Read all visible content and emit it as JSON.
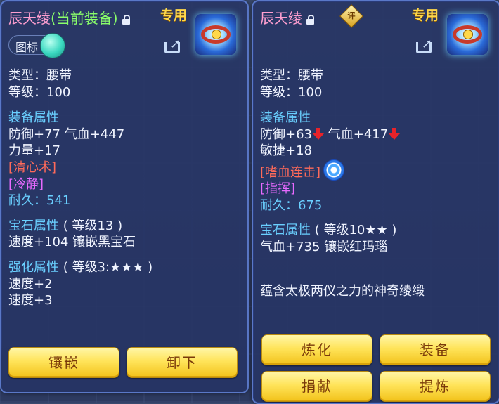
{
  "left": {
    "name": "辰天绫",
    "equipped_tag": "(当前装备)",
    "special": "专用",
    "icon_toggle_label": "图标",
    "type": "类型：腰带",
    "level": "等级：100",
    "equip_attr_title": "装备属性",
    "attr_line1": "防御+77 气血+447",
    "attr_line2": "力量+17",
    "skill1": "[清心术]",
    "skill2": "[冷静]",
    "durability_label": "耐久：",
    "durability_value": "541",
    "gem_title": "宝石属性",
    "gem_level": "( 等级13 )",
    "gem_line": "速度+104 镶嵌黑宝石",
    "enhance_title": "强化属性",
    "enhance_level": "( 等级3:★★★ )",
    "enhance_line1": "速度+2",
    "enhance_line2": "速度+3",
    "buttons": {
      "inlay": "镶嵌",
      "unequip": "卸下"
    }
  },
  "right": {
    "name": "辰天绫",
    "rate_badge": "评",
    "special": "专用",
    "type": "类型：腰带",
    "level": "等级：100",
    "equip_attr_title": "装备属性",
    "attr_def": "防御+63",
    "attr_hp": "气血+417",
    "attr_line2": "敏捷+18",
    "skill1": "[嗜血连击]",
    "skill2": "[指挥]",
    "durability_label": "耐久：",
    "durability_value": "675",
    "gem_title": "宝石属性",
    "gem_level": "( 等级10★★ )",
    "gem_line": "气血+735 镶嵌红玛瑙",
    "description": "蕴含太极两仪之力的神奇绫缎",
    "buttons": {
      "refine": "炼化",
      "equip": "装备",
      "donate": "捐献",
      "extract": "提炼"
    }
  },
  "icons": [
    "lock-icon",
    "share-icon",
    "belt-item-icon",
    "down-arrow-icon",
    "skill-swirl-icon"
  ],
  "colors": {
    "name": "#ff9fd0",
    "equipped": "#8aff6a",
    "section": "#6ad0ff",
    "skill_red": "#ff6a5a",
    "skill_magenta": "#e86aff",
    "button": "#ffe45a",
    "downgrade_arrow": "#e8232a"
  }
}
